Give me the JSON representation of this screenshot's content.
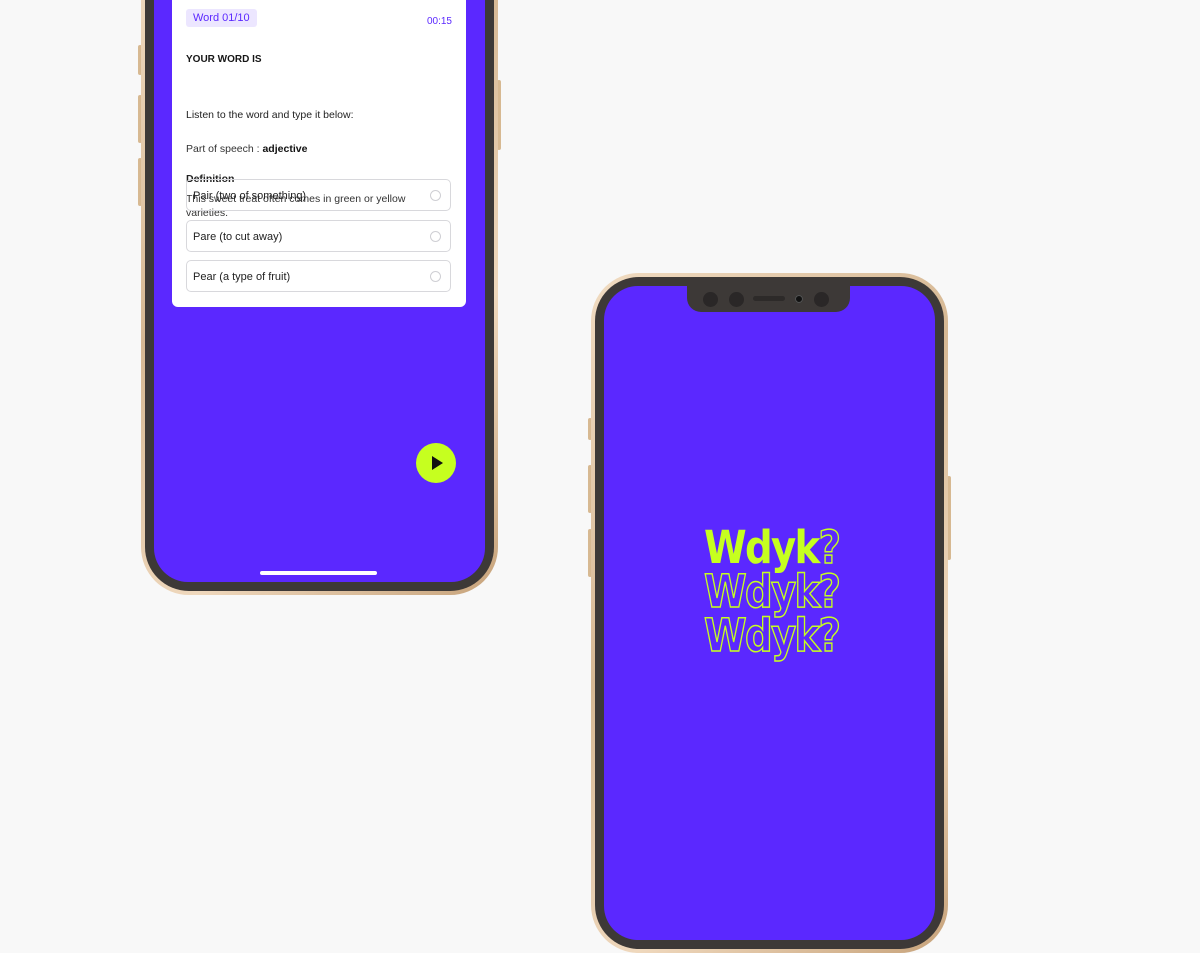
{
  "quiz_screen": {
    "word_counter": "Word 01/10",
    "timer": "00:15",
    "heading": "YOUR WORD IS",
    "instruction": "Listen to the word and type it below:",
    "part_of_speech_label": "Part of speech : ",
    "part_of_speech_value": "adjective",
    "definition_label": "Definition",
    "definition_text": "This sweet treat often comes in green or yellow varieties.",
    "options": [
      {
        "label": "Pair (two of something)",
        "selected": false
      },
      {
        "label": "Pare (to cut away)",
        "selected": false
      },
      {
        "label": "Pear (a type of fruit)",
        "selected": false
      }
    ],
    "play_button_icon": "play-icon"
  },
  "splash_screen": {
    "logo_lines": [
      "Wdyk",
      "Wdyk",
      "Wdyk"
    ],
    "logo_question": "?"
  },
  "colors": {
    "background": "#f8f8f8",
    "brand_purple": "#5b28ff",
    "accent_lime": "#c6ff1f",
    "device_gold": "#d6b894"
  }
}
